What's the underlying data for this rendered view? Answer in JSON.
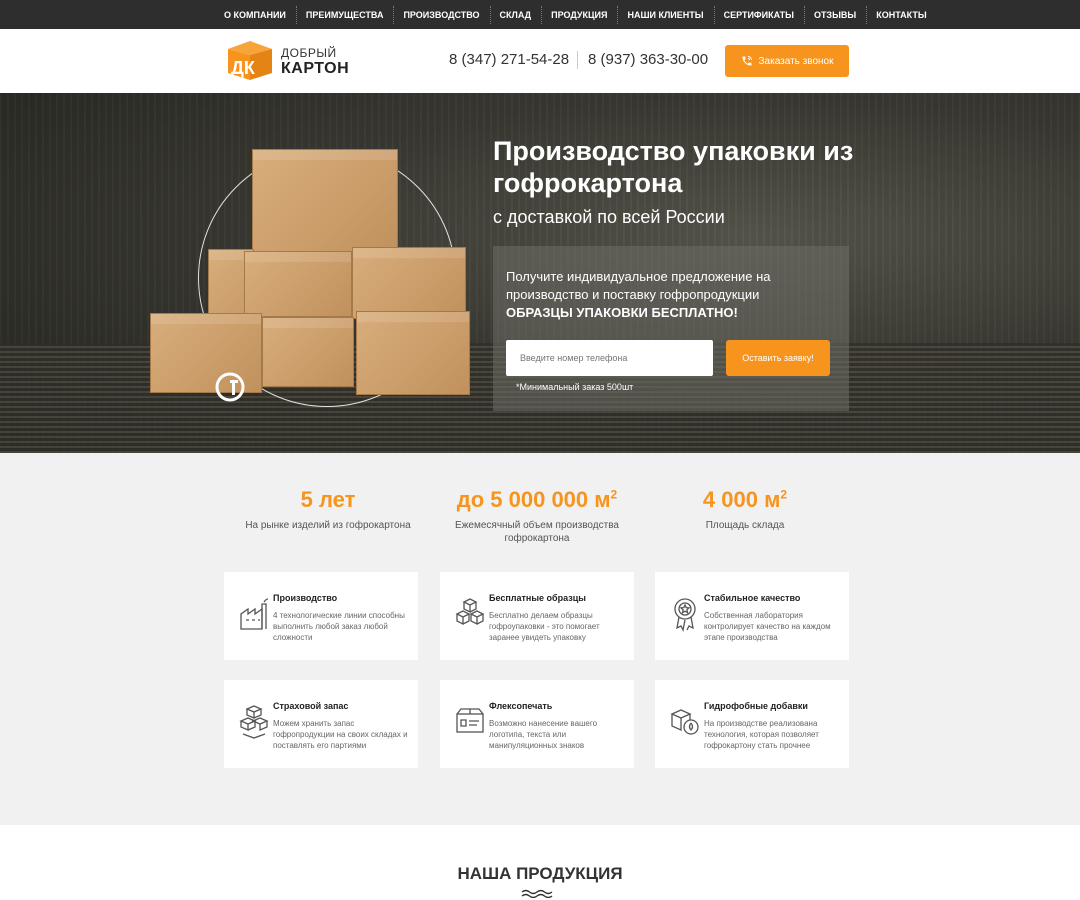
{
  "nav": {
    "items": [
      "О компании",
      "Преимущества",
      "Производство",
      "Склад",
      "Продукция",
      "Наши клиенты",
      "Сертификаты",
      "Отзывы",
      "Контакты"
    ]
  },
  "header": {
    "logo_line1": "ДОБРЫЙ",
    "logo_line2": "КАРТОН",
    "logo_mark": "ДК",
    "phone1": "8 (347) 271-54-28",
    "phone2": "8 (937) 363-30-00",
    "callback_label": "Заказать звонок",
    "callback_icon": "phone-icon"
  },
  "hero": {
    "title": "Производство упаковки из гофрокартона",
    "subtitle": "с доставкой по всей России",
    "panel_text": "Получите индивидуальное предложение на производство и поставку гофропродукции",
    "panel_bold": "ОБРАЗЦЫ УПАКОВКИ БЕСПЛАТНО!",
    "input_placeholder": "Введите номер телефона",
    "submit_label": "Оставить заявку!",
    "min_order": "*Минимальный заказ 500шт",
    "cert_mark": "РСТ"
  },
  "stats": [
    {
      "value": "5 лет",
      "sup": "",
      "desc": "На рынке изделий из гофрокартона"
    },
    {
      "value": "до 5 000 000 м",
      "sup": "2",
      "desc": "Ежемесячный объем производства гофрокартона"
    },
    {
      "value": "4 000 м",
      "sup": "2",
      "desc": "Площадь склада"
    }
  ],
  "features": [
    {
      "title": "Производство",
      "text": "4 технологические линии способны выполнить любой заказ любой сложности",
      "icon": "factory-icon"
    },
    {
      "title": "Бесплатные образцы",
      "text": "Бесплатно делаем образцы гофроупаковки - это помогает заранее увидеть упаковку",
      "icon": "boxes-icon"
    },
    {
      "title": "Стабильное качество",
      "text": "Собственная лаборатория контролирует качество на каждом этапе производства",
      "icon": "quality-badge-icon"
    },
    {
      "title": "Страховой запас",
      "text": "Можем хранить запас гофропродукции на своих складах и поставлять его партиями",
      "icon": "stacked-boxes-icon"
    },
    {
      "title": "Флексопечать",
      "text": "Возможно нанесение вашего логотипа, текста или манипуляционных знаков",
      "icon": "printed-box-icon"
    },
    {
      "title": "Гидрофобные добавки",
      "text": "На производстве реализована технология, которая позволяет гофрокартону стать прочнее",
      "icon": "water-box-icon"
    }
  ],
  "products_heading": "НАША ПРОДУКЦИЯ",
  "colors": {
    "accent": "#f7941d",
    "nav_bg": "#2e2e2e",
    "section_bg": "#f1f1f1"
  }
}
